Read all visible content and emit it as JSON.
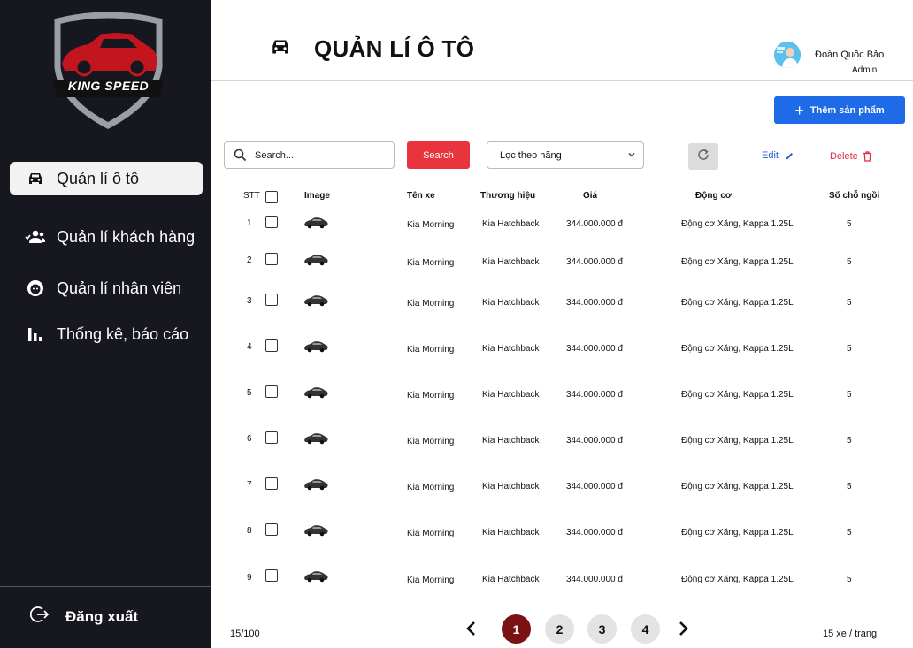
{
  "brand": {
    "name": "KING SPEED"
  },
  "sidebar": {
    "items": [
      {
        "label": "Quản lí ô tô",
        "icon": "car-icon",
        "active": true
      },
      {
        "label": "Quản lí khách hàng",
        "icon": "users-icon",
        "active": false
      },
      {
        "label": "Quản lí nhân viên",
        "icon": "employee-icon",
        "active": false
      },
      {
        "label": "Thống kê, báo cáo",
        "icon": "bar-chart-icon",
        "active": false
      }
    ],
    "logout_label": "Đăng xuất"
  },
  "header": {
    "title": "QUẢN LÍ Ô TÔ",
    "user_name": "Đoàn Quốc Bảo",
    "user_role": "Admin"
  },
  "toolbar": {
    "add_label": "Thêm sản phẩm",
    "search_placeholder": "Search...",
    "search_button": "Search",
    "filter_label": "Lọc theo hãng",
    "edit_label": "Edit",
    "delete_label": "Delete"
  },
  "table": {
    "columns": [
      "STT",
      "Image",
      "Tên xe",
      "Thương hiệu",
      "Giá",
      "Động cơ",
      "Số chỗ ngồi"
    ],
    "rows": [
      {
        "stt": "1",
        "name": "Kia Morning",
        "brand": "Kia Hatchback",
        "price": "344.000.000 đ",
        "engine": "Động cơ Xăng, Kappa 1.25L",
        "seats": "5"
      },
      {
        "stt": "2",
        "name": "Kia Morning",
        "brand": "Kia Hatchback",
        "price": "344.000.000 đ",
        "engine": "Động cơ Xăng, Kappa 1.25L",
        "seats": "5"
      },
      {
        "stt": "3",
        "name": "Kia Morning",
        "brand": "Kia Hatchback",
        "price": "344.000.000 đ",
        "engine": "Động cơ Xăng, Kappa 1.25L",
        "seats": "5"
      },
      {
        "stt": "4",
        "name": "Kia Morning",
        "brand": "Kia Hatchback",
        "price": "344.000.000 đ",
        "engine": "Động cơ Xăng, Kappa 1.25L",
        "seats": "5"
      },
      {
        "stt": "5",
        "name": "Kia Morning",
        "brand": "Kia Hatchback",
        "price": "344.000.000 đ",
        "engine": "Động cơ Xăng, Kappa 1.25L",
        "seats": "5"
      },
      {
        "stt": "6",
        "name": "Kia Morning",
        "brand": "Kia Hatchback",
        "price": "344.000.000 đ",
        "engine": "Động cơ Xăng, Kappa 1.25L",
        "seats": "5"
      },
      {
        "stt": "7",
        "name": "Kia Morning",
        "brand": "Kia Hatchback",
        "price": "344.000.000 đ",
        "engine": "Động cơ Xăng, Kappa 1.25L",
        "seats": "5"
      },
      {
        "stt": "8",
        "name": "Kia Morning",
        "brand": "Kia Hatchback",
        "price": "344.000.000 đ",
        "engine": "Động cơ Xăng, Kappa 1.25L",
        "seats": "5"
      },
      {
        "stt": "9",
        "name": "Kia Morning",
        "brand": "Kia Hatchback",
        "price": "344.000.000 đ",
        "engine": "Động cơ Xăng, Kappa 1.25L",
        "seats": "5"
      }
    ]
  },
  "footer": {
    "count": "15/100",
    "pages": [
      "1",
      "2",
      "3",
      "4"
    ],
    "active_page": "1",
    "per_page": "15 xe / trang"
  },
  "colors": {
    "sidebar_bg": "#16171f",
    "primary": "#1f6ae6",
    "danger": "#e8343c",
    "active_page": "#7a1115"
  }
}
